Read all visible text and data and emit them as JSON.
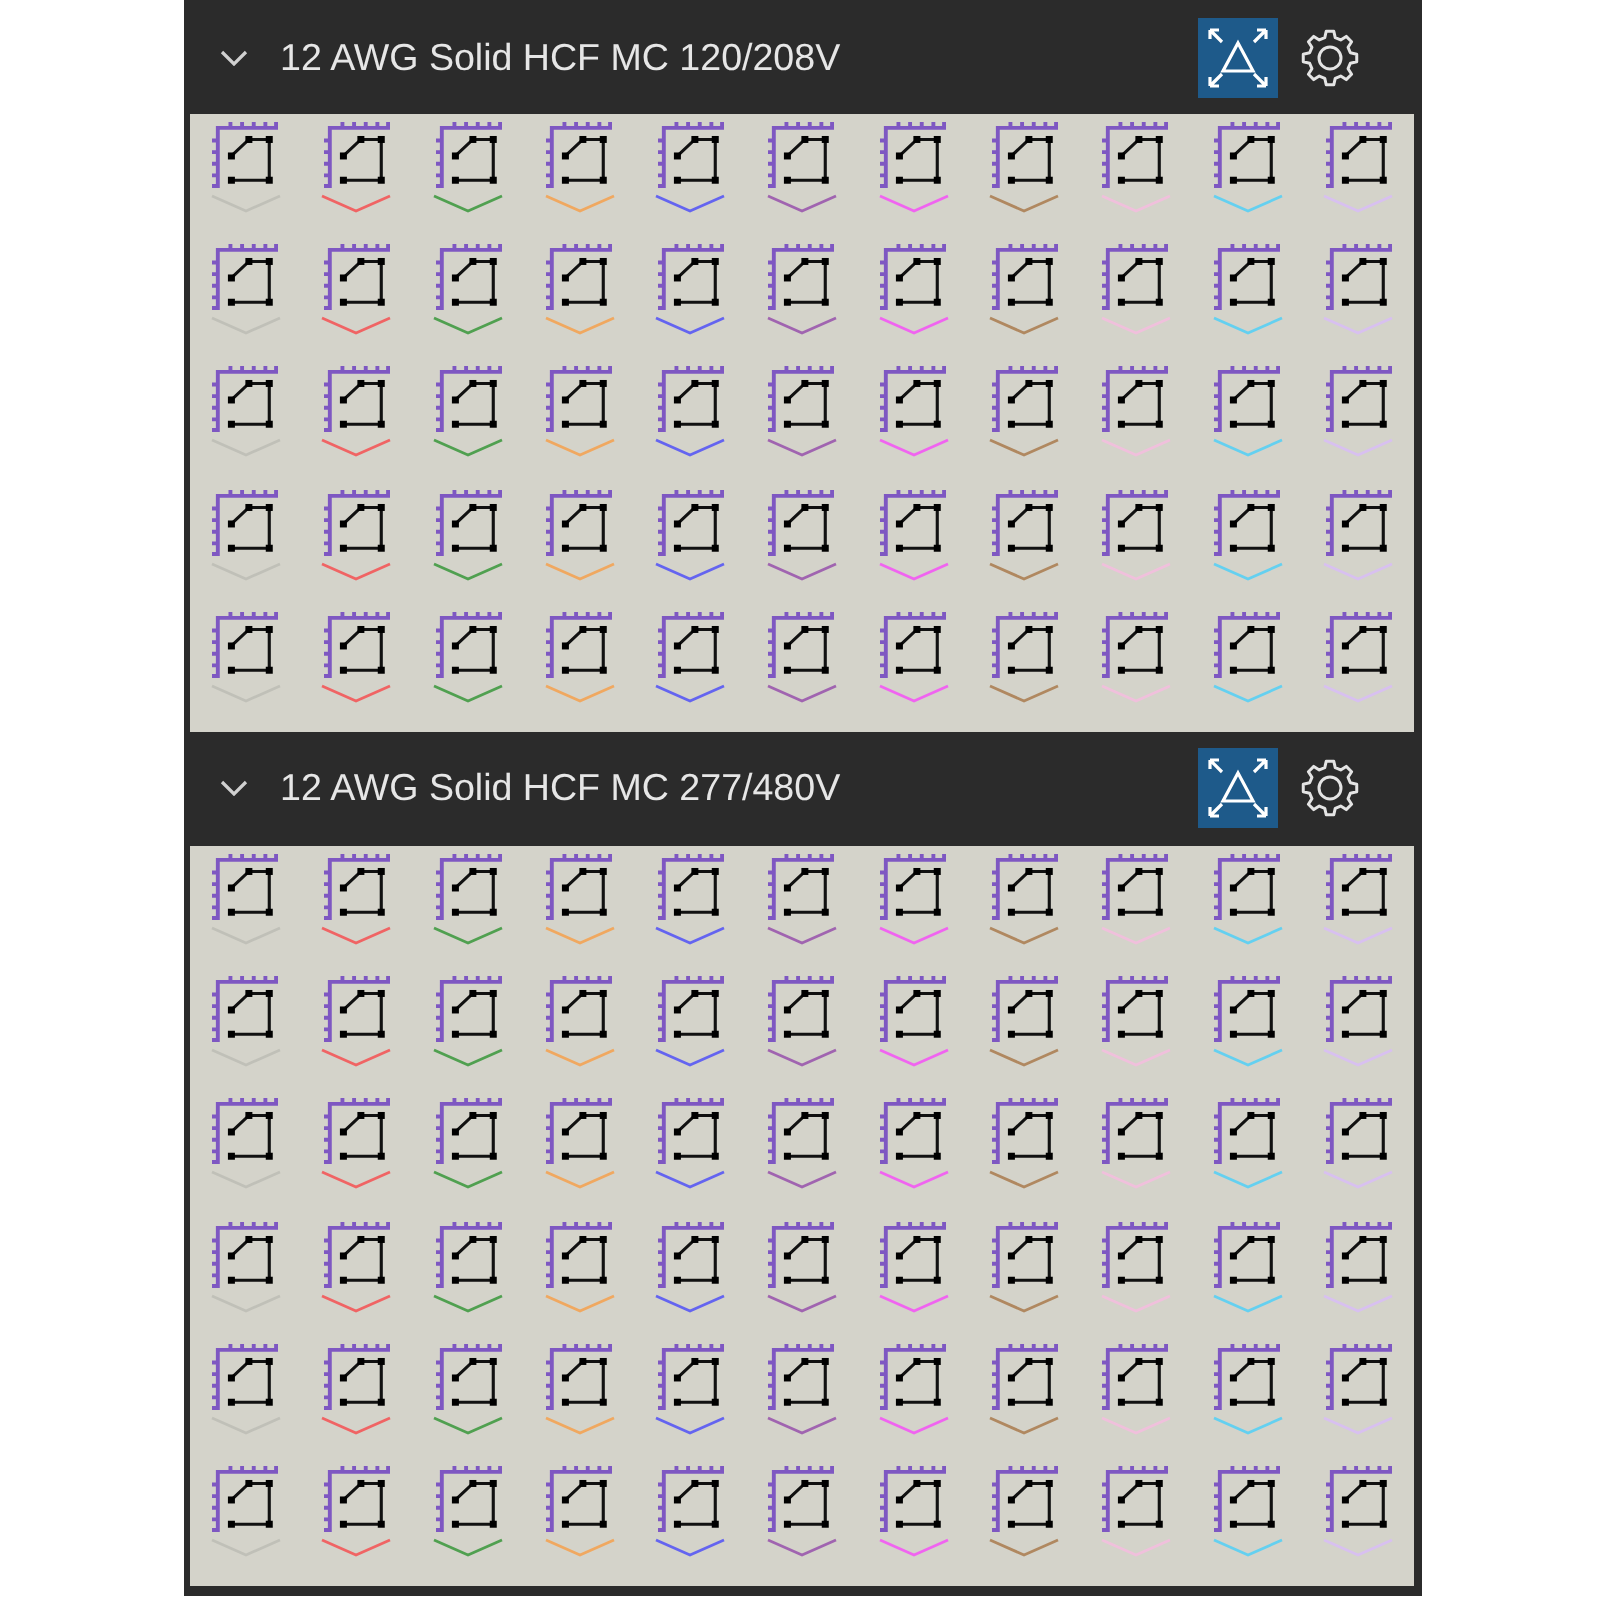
{
  "sections": [
    {
      "title": "12 AWG Solid HCF MC 120/208V",
      "expanded": true,
      "view_button": {
        "active": true
      },
      "items": [
        {
          "color": "#c0c0b8"
        },
        {
          "color": "#f06464"
        },
        {
          "color": "#50a050"
        },
        {
          "color": "#f0a860"
        },
        {
          "color": "#6464f0"
        },
        {
          "color": "#a064b0"
        },
        {
          "color": "#f064f0"
        },
        {
          "color": "#b08860"
        },
        {
          "color": "#f0c0dc"
        },
        {
          "color": "#64d0f0"
        },
        {
          "color": "#d8c0f0"
        },
        {
          "color": "#c0c0b8"
        },
        {
          "color": "#f06464"
        },
        {
          "color": "#50a050"
        },
        {
          "color": "#f0a860"
        },
        {
          "color": "#6464f0"
        },
        {
          "color": "#a064b0"
        },
        {
          "color": "#f064f0"
        },
        {
          "color": "#b08860"
        },
        {
          "color": "#f0c0dc"
        },
        {
          "color": "#64d0f0"
        },
        {
          "color": "#d8c0f0"
        },
        {
          "color": "#c0c0b8"
        },
        {
          "color": "#f06464"
        },
        {
          "color": "#50a050"
        },
        {
          "color": "#f0a860"
        },
        {
          "color": "#6464f0"
        },
        {
          "color": "#a064b0"
        },
        {
          "color": "#f064f0"
        },
        {
          "color": "#b08860"
        },
        {
          "color": "#f0c0dc"
        },
        {
          "color": "#64d0f0"
        },
        {
          "color": "#d8c0f0"
        },
        {
          "color": "#c0c0b8"
        },
        {
          "color": "#f06464"
        },
        {
          "color": "#50a050"
        },
        {
          "color": "#f0a860"
        },
        {
          "color": "#6464f0"
        },
        {
          "color": "#a064b0"
        },
        {
          "color": "#f064f0"
        },
        {
          "color": "#b08860"
        },
        {
          "color": "#f0c0dc"
        },
        {
          "color": "#64d0f0"
        },
        {
          "color": "#d8c0f0"
        },
        {
          "color": "#c0c0b8"
        },
        {
          "color": "#f06464"
        },
        {
          "color": "#50a050"
        },
        {
          "color": "#f0a860"
        },
        {
          "color": "#6464f0"
        },
        {
          "color": "#a064b0"
        },
        {
          "color": "#f064f0"
        },
        {
          "color": "#b08860"
        },
        {
          "color": "#f0c0dc"
        },
        {
          "color": "#64d0f0"
        },
        {
          "color": "#d8c0f0"
        }
      ]
    },
    {
      "title": "12 AWG Solid HCF MC 277/480V",
      "expanded": true,
      "view_button": {
        "active": true
      },
      "items": [
        {
          "color": "#c0c0b8"
        },
        {
          "color": "#f06464"
        },
        {
          "color": "#50a050"
        },
        {
          "color": "#f0a860"
        },
        {
          "color": "#6464f0"
        },
        {
          "color": "#a064b0"
        },
        {
          "color": "#f064f0"
        },
        {
          "color": "#b08860"
        },
        {
          "color": "#f0c0dc"
        },
        {
          "color": "#64d0f0"
        },
        {
          "color": "#d8c0f0"
        },
        {
          "color": "#c0c0b8"
        },
        {
          "color": "#f06464"
        },
        {
          "color": "#50a050"
        },
        {
          "color": "#f0a860"
        },
        {
          "color": "#6464f0"
        },
        {
          "color": "#a064b0"
        },
        {
          "color": "#f064f0"
        },
        {
          "color": "#b08860"
        },
        {
          "color": "#f0c0dc"
        },
        {
          "color": "#64d0f0"
        },
        {
          "color": "#d8c0f0"
        },
        {
          "color": "#c0c0b8"
        },
        {
          "color": "#f06464"
        },
        {
          "color": "#50a050"
        },
        {
          "color": "#f0a860"
        },
        {
          "color": "#6464f0"
        },
        {
          "color": "#a064b0"
        },
        {
          "color": "#f064f0"
        },
        {
          "color": "#b08860"
        },
        {
          "color": "#f0c0dc"
        },
        {
          "color": "#64d0f0"
        },
        {
          "color": "#d8c0f0"
        },
        {
          "color": "#c0c0b8"
        },
        {
          "color": "#f06464"
        },
        {
          "color": "#50a050"
        },
        {
          "color": "#f0a860"
        },
        {
          "color": "#6464f0"
        },
        {
          "color": "#a064b0"
        },
        {
          "color": "#f064f0"
        },
        {
          "color": "#b08860"
        },
        {
          "color": "#f0c0dc"
        },
        {
          "color": "#64d0f0"
        },
        {
          "color": "#d8c0f0"
        },
        {
          "color": "#c0c0b8"
        },
        {
          "color": "#f06464"
        },
        {
          "color": "#50a050"
        },
        {
          "color": "#f0a860"
        },
        {
          "color": "#6464f0"
        },
        {
          "color": "#a064b0"
        },
        {
          "color": "#f064f0"
        },
        {
          "color": "#b08860"
        },
        {
          "color": "#f0c0dc"
        },
        {
          "color": "#64d0f0"
        },
        {
          "color": "#d8c0f0"
        },
        {
          "color": "#c0c0b8"
        },
        {
          "color": "#f06464"
        },
        {
          "color": "#50a050"
        },
        {
          "color": "#f0a860"
        },
        {
          "color": "#6464f0"
        },
        {
          "color": "#a064b0"
        },
        {
          "color": "#f064f0"
        },
        {
          "color": "#b08860"
        },
        {
          "color": "#f0c0dc"
        },
        {
          "color": "#64d0f0"
        },
        {
          "color": "#d8c0f0"
        }
      ]
    }
  ]
}
